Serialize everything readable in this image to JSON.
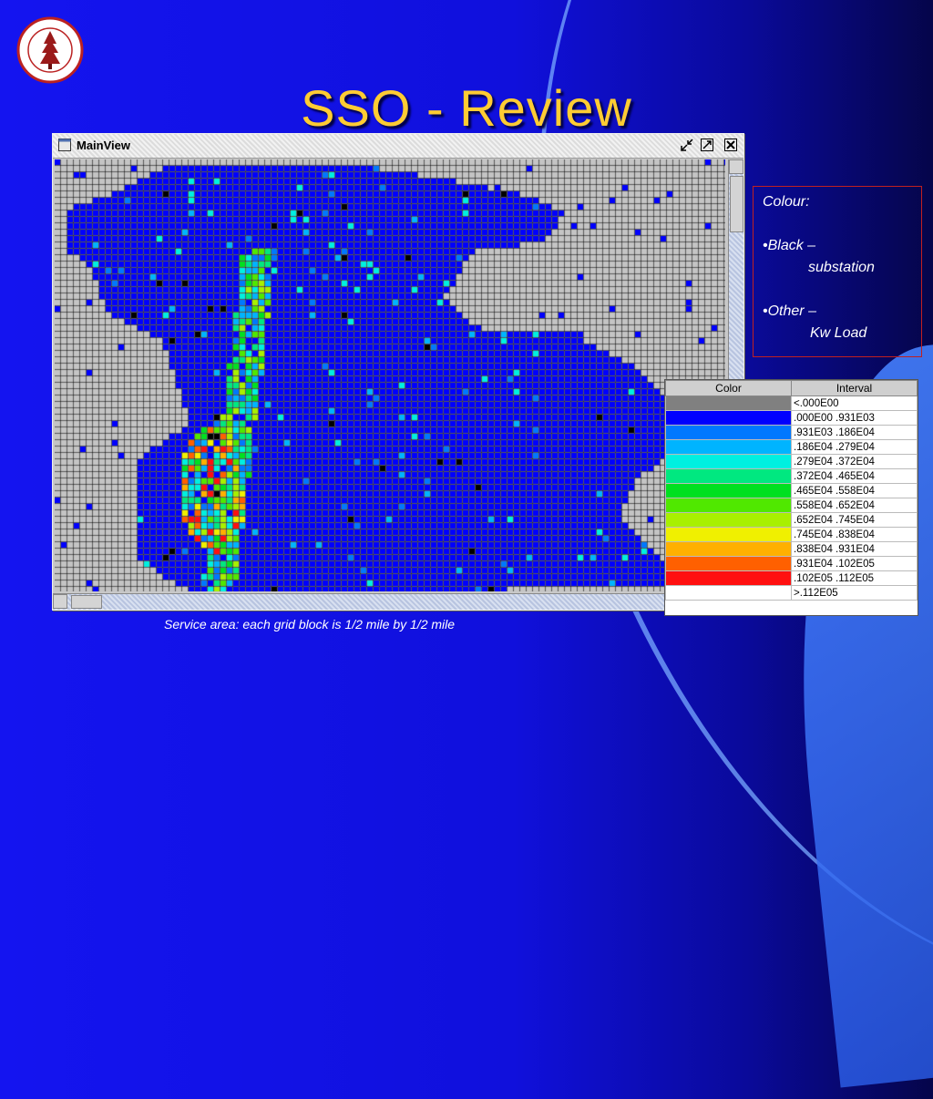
{
  "slide": {
    "title": "SSO - Review",
    "caption": "Service area: each grid block is 1/2 mile by 1/2 mile",
    "logo_text": "LELAND STANFORD JUNIOR UNIVERSITY ORGANIZED 1891"
  },
  "window": {
    "title": "MainView",
    "icons": [
      "window-icon",
      "restore-icon",
      "close-icon"
    ]
  },
  "legend": {
    "heading": "Colour:",
    "black_label": "•Black –",
    "black_desc": "substation",
    "other_label": "•Other –",
    "other_desc": "Kw Load"
  },
  "color_table": {
    "headers": [
      "Color",
      "Interval"
    ],
    "rows": [
      {
        "color": "#808080",
        "interval": "<.000E00"
      },
      {
        "color": "#0000ff",
        "interval": ".000E00  .931E03"
      },
      {
        "color": "#0078ff",
        "interval": ".931E03  .186E04"
      },
      {
        "color": "#00b4ff",
        "interval": ".186E04  .279E04"
      },
      {
        "color": "#00f0e0",
        "interval": ".279E04  .372E04"
      },
      {
        "color": "#00e880",
        "interval": ".372E04  .465E04"
      },
      {
        "color": "#00e020",
        "interval": ".465E04  .558E04"
      },
      {
        "color": "#50e800",
        "interval": ".558E04  .652E04"
      },
      {
        "color": "#a8f000",
        "interval": ".652E04  .745E04"
      },
      {
        "color": "#f0f000",
        "interval": ".745E04  .838E04"
      },
      {
        "color": "#ffb000",
        "interval": ".838E04  .931E04"
      },
      {
        "color": "#ff6000",
        "interval": ".931E04  .102E05"
      },
      {
        "color": "#ff1010",
        "interval": ".102E05  .112E05"
      },
      {
        "color": "#ffffff",
        "interval": ">.112E05"
      }
    ]
  },
  "colors": {
    "background": "#1414f0",
    "title": "#ffcc33",
    "land": "#c4c4c4",
    "water": "#0000ff",
    "substation": "#000000"
  }
}
